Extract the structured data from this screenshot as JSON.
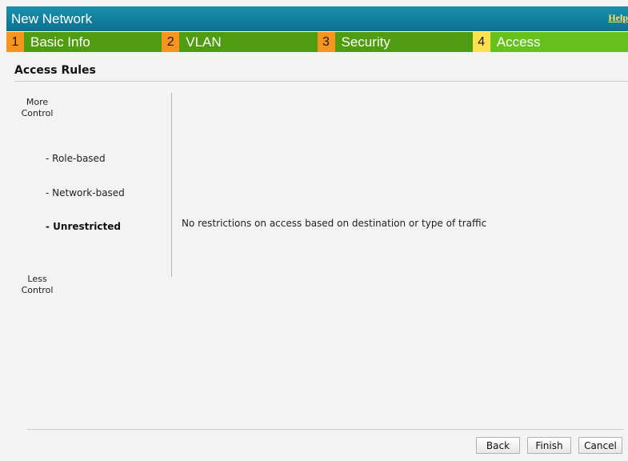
{
  "header": {
    "title": "New Network",
    "help_label": "Help"
  },
  "steps": [
    {
      "number": "1",
      "label": "Basic Info",
      "active": false
    },
    {
      "number": "2",
      "label": "VLAN",
      "active": false
    },
    {
      "number": "3",
      "label": "Security",
      "active": false
    },
    {
      "number": "4",
      "label": "Access",
      "active": true
    }
  ],
  "access_rules": {
    "title": "Access Rules",
    "more_control": [
      "More",
      "Control"
    ],
    "less_control": [
      "Less",
      "Control"
    ],
    "options": [
      {
        "label": "- Role-based",
        "selected": false
      },
      {
        "label": "- Network-based",
        "selected": false
      },
      {
        "label": "- Unrestricted",
        "selected": true
      }
    ],
    "description": "No restrictions on access based on destination or type of traffic"
  },
  "buttons": {
    "back": "Back",
    "finish": "Finish",
    "cancel": "Cancel"
  },
  "colors": {
    "titlebar": "#0c7190",
    "step_number": "#f7941d",
    "step_number_active": "#ffe14d",
    "step_label": "#4f9c10",
    "step_label_active": "#66c21b",
    "help_link": "#ffe36b"
  }
}
